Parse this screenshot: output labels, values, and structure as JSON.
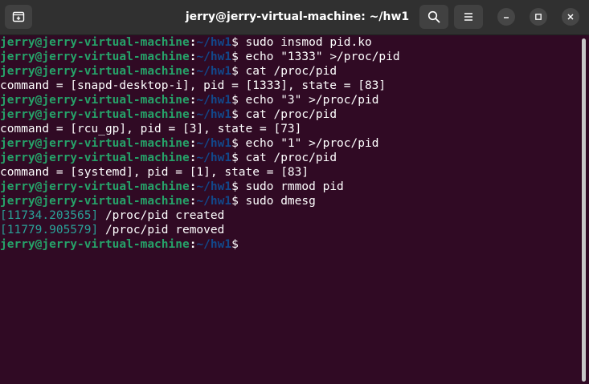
{
  "window": {
    "title": "jerry@jerry-virtual-machine: ~/hw1"
  },
  "titlebar": {
    "new_tab_icon": "new-tab-icon",
    "search_icon": "search-icon",
    "menu_icon": "hamburger-menu-icon",
    "minimize_icon": "minimize-icon",
    "maximize_icon": "maximize-icon",
    "close_icon": "close-icon"
  },
  "prompt": {
    "user_host": "jerry@jerry-virtual-machine",
    "colon": ":",
    "path": "~/hw1",
    "symbol": "$"
  },
  "lines": [
    {
      "command": " sudo insmod pid.ko"
    },
    {
      "command": " echo \"1333\" >/proc/pid"
    },
    {
      "command": " cat /proc/pid"
    },
    {
      "output": "command = [snapd-desktop-i], pid = [1333], state = [83]"
    },
    {
      "command": " echo \"3\" >/proc/pid"
    },
    {
      "command": " cat /proc/pid"
    },
    {
      "output": "command = [rcu_gp], pid = [3], state = [73]"
    },
    {
      "command": " echo \"1\" >/proc/pid"
    },
    {
      "command": " cat /proc/pid"
    },
    {
      "output": "command = [systemd], pid = [1], state = [83]"
    },
    {
      "command": " sudo rmmod pid"
    },
    {
      "command": " sudo dmesg"
    },
    {
      "timestamp": "[11734.203565]",
      "output": " /proc/pid created"
    },
    {
      "timestamp": "[11779.905579]",
      "output": " /proc/pid removed"
    },
    {
      "command": ""
    }
  ],
  "colors": {
    "background": "#300a24",
    "titlebar": "#303030",
    "prompt_user": "#26a269",
    "prompt_path": "#12488b",
    "timestamp": "#2aa198"
  }
}
